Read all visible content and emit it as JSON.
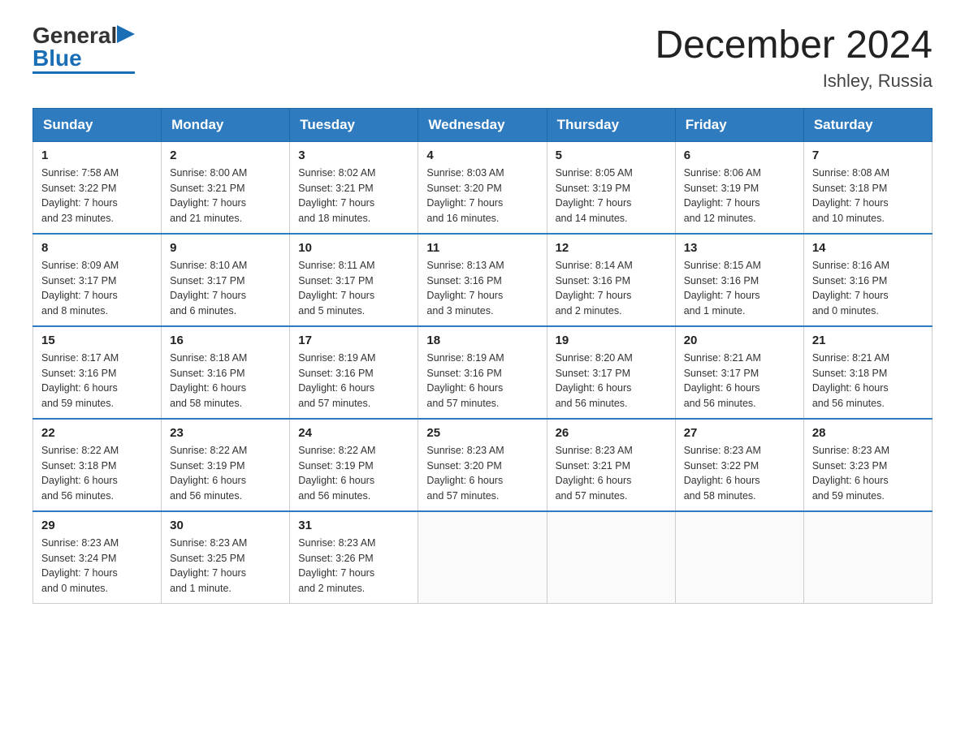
{
  "logo": {
    "general": "General",
    "blue": "Blue",
    "arrow": "▶"
  },
  "title": "December 2024",
  "location": "Ishley, Russia",
  "weekdays": [
    "Sunday",
    "Monday",
    "Tuesday",
    "Wednesday",
    "Thursday",
    "Friday",
    "Saturday"
  ],
  "weeks": [
    [
      {
        "day": "1",
        "sunrise": "7:58 AM",
        "sunset": "3:22 PM",
        "daylight": "7 hours and 23 minutes."
      },
      {
        "day": "2",
        "sunrise": "8:00 AM",
        "sunset": "3:21 PM",
        "daylight": "7 hours and 21 minutes."
      },
      {
        "day": "3",
        "sunrise": "8:02 AM",
        "sunset": "3:21 PM",
        "daylight": "7 hours and 18 minutes."
      },
      {
        "day": "4",
        "sunrise": "8:03 AM",
        "sunset": "3:20 PM",
        "daylight": "7 hours and 16 minutes."
      },
      {
        "day": "5",
        "sunrise": "8:05 AM",
        "sunset": "3:19 PM",
        "daylight": "7 hours and 14 minutes."
      },
      {
        "day": "6",
        "sunrise": "8:06 AM",
        "sunset": "3:19 PM",
        "daylight": "7 hours and 12 minutes."
      },
      {
        "day": "7",
        "sunrise": "8:08 AM",
        "sunset": "3:18 PM",
        "daylight": "7 hours and 10 minutes."
      }
    ],
    [
      {
        "day": "8",
        "sunrise": "8:09 AM",
        "sunset": "3:17 PM",
        "daylight": "7 hours and 8 minutes."
      },
      {
        "day": "9",
        "sunrise": "8:10 AM",
        "sunset": "3:17 PM",
        "daylight": "7 hours and 6 minutes."
      },
      {
        "day": "10",
        "sunrise": "8:11 AM",
        "sunset": "3:17 PM",
        "daylight": "7 hours and 5 minutes."
      },
      {
        "day": "11",
        "sunrise": "8:13 AM",
        "sunset": "3:16 PM",
        "daylight": "7 hours and 3 minutes."
      },
      {
        "day": "12",
        "sunrise": "8:14 AM",
        "sunset": "3:16 PM",
        "daylight": "7 hours and 2 minutes."
      },
      {
        "day": "13",
        "sunrise": "8:15 AM",
        "sunset": "3:16 PM",
        "daylight": "7 hours and 1 minute."
      },
      {
        "day": "14",
        "sunrise": "8:16 AM",
        "sunset": "3:16 PM",
        "daylight": "7 hours and 0 minutes."
      }
    ],
    [
      {
        "day": "15",
        "sunrise": "8:17 AM",
        "sunset": "3:16 PM",
        "daylight": "6 hours and 59 minutes."
      },
      {
        "day": "16",
        "sunrise": "8:18 AM",
        "sunset": "3:16 PM",
        "daylight": "6 hours and 58 minutes."
      },
      {
        "day": "17",
        "sunrise": "8:19 AM",
        "sunset": "3:16 PM",
        "daylight": "6 hours and 57 minutes."
      },
      {
        "day": "18",
        "sunrise": "8:19 AM",
        "sunset": "3:16 PM",
        "daylight": "6 hours and 57 minutes."
      },
      {
        "day": "19",
        "sunrise": "8:20 AM",
        "sunset": "3:17 PM",
        "daylight": "6 hours and 56 minutes."
      },
      {
        "day": "20",
        "sunrise": "8:21 AM",
        "sunset": "3:17 PM",
        "daylight": "6 hours and 56 minutes."
      },
      {
        "day": "21",
        "sunrise": "8:21 AM",
        "sunset": "3:18 PM",
        "daylight": "6 hours and 56 minutes."
      }
    ],
    [
      {
        "day": "22",
        "sunrise": "8:22 AM",
        "sunset": "3:18 PM",
        "daylight": "6 hours and 56 minutes."
      },
      {
        "day": "23",
        "sunrise": "8:22 AM",
        "sunset": "3:19 PM",
        "daylight": "6 hours and 56 minutes."
      },
      {
        "day": "24",
        "sunrise": "8:22 AM",
        "sunset": "3:19 PM",
        "daylight": "6 hours and 56 minutes."
      },
      {
        "day": "25",
        "sunrise": "8:23 AM",
        "sunset": "3:20 PM",
        "daylight": "6 hours and 57 minutes."
      },
      {
        "day": "26",
        "sunrise": "8:23 AM",
        "sunset": "3:21 PM",
        "daylight": "6 hours and 57 minutes."
      },
      {
        "day": "27",
        "sunrise": "8:23 AM",
        "sunset": "3:22 PM",
        "daylight": "6 hours and 58 minutes."
      },
      {
        "day": "28",
        "sunrise": "8:23 AM",
        "sunset": "3:23 PM",
        "daylight": "6 hours and 59 minutes."
      }
    ],
    [
      {
        "day": "29",
        "sunrise": "8:23 AM",
        "sunset": "3:24 PM",
        "daylight": "7 hours and 0 minutes."
      },
      {
        "day": "30",
        "sunrise": "8:23 AM",
        "sunset": "3:25 PM",
        "daylight": "7 hours and 1 minute."
      },
      {
        "day": "31",
        "sunrise": "8:23 AM",
        "sunset": "3:26 PM",
        "daylight": "7 hours and 2 minutes."
      },
      null,
      null,
      null,
      null
    ]
  ],
  "labels": {
    "sunrise": "Sunrise:",
    "sunset": "Sunset:",
    "daylight": "Daylight:"
  }
}
